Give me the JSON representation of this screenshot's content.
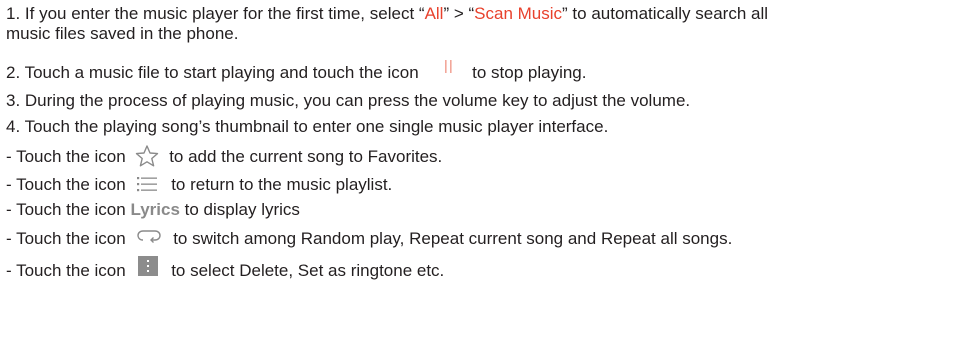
{
  "doc": {
    "step1": {
      "prefix": "1. If you enter the music player for the first time, select “",
      "all_label": "All",
      "mid": "” > “",
      "scan_label": "Scan Music",
      "suffix": "” to automatically search all",
      "cont": "music files saved in the phone."
    },
    "step2": {
      "before": "2. Touch a music file to start playing and touch the icon",
      "after": "to stop playing."
    },
    "step3": "3. During the process of playing music, you can press the volume key to adjust the volume.",
    "step4": "4. Touch the playing song’s thumbnail to enter one single music player interface.",
    "bullets": {
      "favorites": {
        "before": "- Touch the icon",
        "after": "to add the current song to Favorites."
      },
      "playlist": {
        "before": "- Touch the icon",
        "after": "to return to the music playlist."
      },
      "lyrics": {
        "before": "- Touch the icon",
        "label": "Lyrics",
        "after": "to display lyrics"
      },
      "repeat": {
        "before": "- Touch the icon",
        "after": "to switch among Random play, Repeat current song and Repeat all songs."
      },
      "menu": {
        "before": "- Touch the icon",
        "after": "to select Delete, Set as ringtone etc."
      }
    },
    "icons": {
      "pause": "pause-icon",
      "favorite": "star-icon",
      "playlist": "list-icon",
      "repeat": "repeat-icon",
      "menu": "more-vertical-icon"
    },
    "colors": {
      "text": "#231f20",
      "accent": "#e8412c",
      "icon_gray": "#8a8a8a"
    }
  }
}
